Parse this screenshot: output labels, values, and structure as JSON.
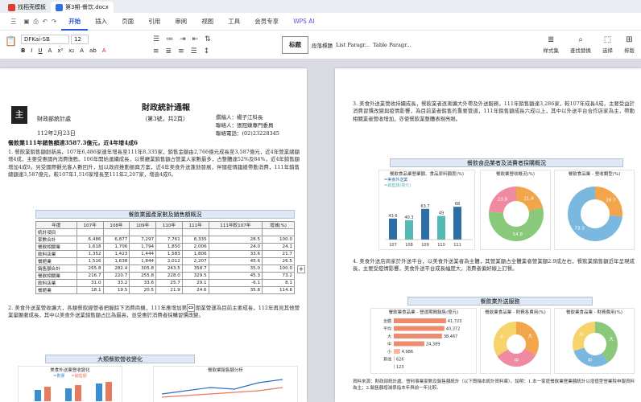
{
  "titlebar": {
    "tabs": [
      {
        "label": "找稻壳模板"
      },
      {
        "label": "第3期-餐饮.docx"
      }
    ]
  },
  "menubar": {
    "items": [
      "三",
      "开始",
      "插入",
      "页面",
      "引用",
      "审阅",
      "视图",
      "工具",
      "会员专享",
      "WPS AI"
    ],
    "active": "开始"
  },
  "toolbar": {
    "font_name": "DFKai-SB",
    "font_size": "12",
    "format_row": [
      "B",
      "I",
      "U",
      "A",
      "x²",
      "x₂",
      "A",
      "ab",
      "A"
    ],
    "styles": [
      "标题",
      "段落標題",
      "List Paragr...",
      "Table Paragr..."
    ],
    "right": [
      {
        "glyph": "≣",
        "label": "样式集"
      },
      {
        "glyph": "⌕",
        "label": "查找替换"
      },
      {
        "glyph": "⬚",
        "label": "选择"
      },
      {
        "glyph": "⊞",
        "label": "排版"
      }
    ]
  },
  "left_page": {
    "logo_char": "主",
    "title": "財政統計通報",
    "subtitle": "（第3號，共2頁）",
    "unit": "財政部統計處",
    "date": "112年2月23日",
    "contact": [
      "撰稿人：楊子江科長",
      "聯絡人：張冠婕專門委員",
      "聯絡電話：(02)23228345"
    ],
    "headline": "餐飲業111年銷售額達3587.3億元，近4年增4成6",
    "para1": "1. 餐飲業銷售額創新高，107年6,486家連年增長至111年8,335家，銷售金額由2,766億元成長至3,587億元，近4年營業總額增4成，主要受惠國內消費復甦。106年開始連續成長，以餐廳業銷售額占營業人家數最多，占整體達52%及84%，近4年銷售額增加4成9。另受國際觀光客人數回升，加以政府推動振興方案，近4年美食外送蓬勃發展，伴隨疫情趨緩帶動消費，111年銷售總額達3,587億元，較107年1,516家增長至111年2,207家，增逾4成6。",
    "table1_title": "餐飲業國產家數及銷售額概況",
    "table1": {
      "head": [
        "年度",
        "107年",
        "108年",
        "109年",
        "110年",
        "111年",
        "111年較107年",
        "增減(%)"
      ],
      "rows": [
        [
          "統計項目",
          "",
          "",
          "",
          "",
          "",
          "",
          ""
        ],
        [
          "家數合計",
          "6,486",
          "6,877",
          "7,297",
          "7,761",
          "8,335",
          "28.5",
          "100.0"
        ],
        [
          "餐飲相關業",
          "1,618",
          "1,706",
          "1,794",
          "1,850",
          "2,006",
          "24.0",
          "24.1"
        ],
        [
          "飲料店業",
          "1,352",
          "1,423",
          "1,444",
          "1,583",
          "1,806",
          "33.6",
          "21.7"
        ],
        [
          "餐館業",
          "1,516",
          "1,638",
          "1,844",
          "2,012",
          "2,207",
          "45.6",
          "26.5"
        ],
        [
          "銷售額合計",
          "265.8",
          "282.4",
          "305.8",
          "243.5",
          "358.7",
          "35.0",
          "100.0"
        ],
        [
          "餐飲相關業",
          "216.7",
          "220.7",
          "255.8",
          "228.0",
          "329.5",
          "45.3",
          "73.2"
        ],
        [
          "飲料店業",
          "31.0",
          "33.2",
          "33.6",
          "25.7",
          "29.1",
          "-6.1",
          "8.1"
        ],
        [
          "餐館業",
          "18.1",
          "19.5",
          "20.5",
          "21.9",
          "24.6",
          "35.8",
          "114.6"
        ]
      ]
    },
    "para2": "2. 美食外送業營收擴大，各類餐飲經營者把握餘下消費商機，111年應增加第6四期業營運為目前主要成長，112年再見其他營業量顯著成長，其中以美食外送業銷售額占比為最高，並受惠於消費者採購習慣改變。",
    "table2_title": "大類餐飲營收變化",
    "chart_titles": [
      "美食外送業營收變化",
      "餐飲業銷售額分析"
    ],
    "legend_left": [
      "=數量",
      "=銷售額"
    ]
  },
  "right_page": {
    "para3": "3. 美食外送業營收持續成長，餐飲業者逐漸擴大外帶及外送服務，111年銷售額達3,286家，較107年成長4成，主要受益於消費習慣改變與疫情影響，為目前業者銷售的重要管道，111年銷售額成長六成以上，其中以外送平台合作店家為主，帶動相關業者營收增加，亦使餐飲業整體表現亮眼。",
    "chart_section_title": "餐飲食品業者及消費者採購概況",
    "chart1": {
      "title": "餐飲食品業營業額、食品原料額度(%)",
      "legend": [
        "=美食外送業",
        "=銷售額(億元)"
      ],
      "categories": [
        "107",
        "108",
        "109",
        "110",
        "111"
      ],
      "bars": [
        43.6,
        40.3,
        63.7,
        49.0,
        68.0
      ]
    },
    "chart2": {
      "title": "餐飲業營收概況(%)",
      "slices": [
        21.4,
        54.8,
        23.8
      ],
      "labels": [
        "21.4",
        "54.8",
        "23.8"
      ]
    },
    "chart3": {
      "title": "餐飲食品業 - 營收類型(%)",
      "slices": [
        26.7,
        73.3
      ],
      "labels": [
        "26.7",
        "73.3"
      ]
    },
    "para4": "4. 美食外送店商家於外送平台，以美食外送業者為主體，其營業額占全體業者營業額2.9成左右，餐飲業銷售額近年呈現成長，主要受疫情影響，美食外送平台成長幅度大，消費者偏好線上訂餐。",
    "chart_section2_title": "餐飲業外送服務",
    "chart4": {
      "title": "餐飲業食品業 - 營運期間銷售(億元)",
      "categories": [
        "全體",
        "平均",
        "大",
        "中",
        "小",
        "其他"
      ],
      "values": [
        41723,
        40372,
        38467,
        24389,
        4986,
        626,
        123
      ],
      "labels": [
        "41,723",
        "40,372",
        "38,467",
        "24,389",
        "4,986",
        "626",
        "123"
      ]
    },
    "chart5": {
      "title": "餐飲業食品業 - 財務各費用(%)",
      "labels": [
        "大",
        "中",
        "小"
      ]
    },
    "chart6": {
      "title": "餐飲業食品業 - 財務費用(%)",
      "labels": [
        "大",
        "中",
        "小"
      ]
    },
    "footnote": "資料來源：財政部統計處、營利事業家數及銷售額統計（以下簡稱本統計資料庫）。說明：1.本一家庭餐飲業營業額統計以增值型營業稅申報資料為主；2.銷售額增減係指本年與前一年比較。"
  },
  "colors": {
    "accent": "#2a5bd7",
    "header_bg": "#dfe8f4",
    "bar_blue": "#3a8fd1",
    "bar_teal": "#67c6c2",
    "bar_orange": "#f2a54a",
    "bar_salmon": "#ee8b6e",
    "pie_green": "#8ac97a",
    "pie_pink": "#f08aa0",
    "pie_yellow": "#f6d46b"
  }
}
